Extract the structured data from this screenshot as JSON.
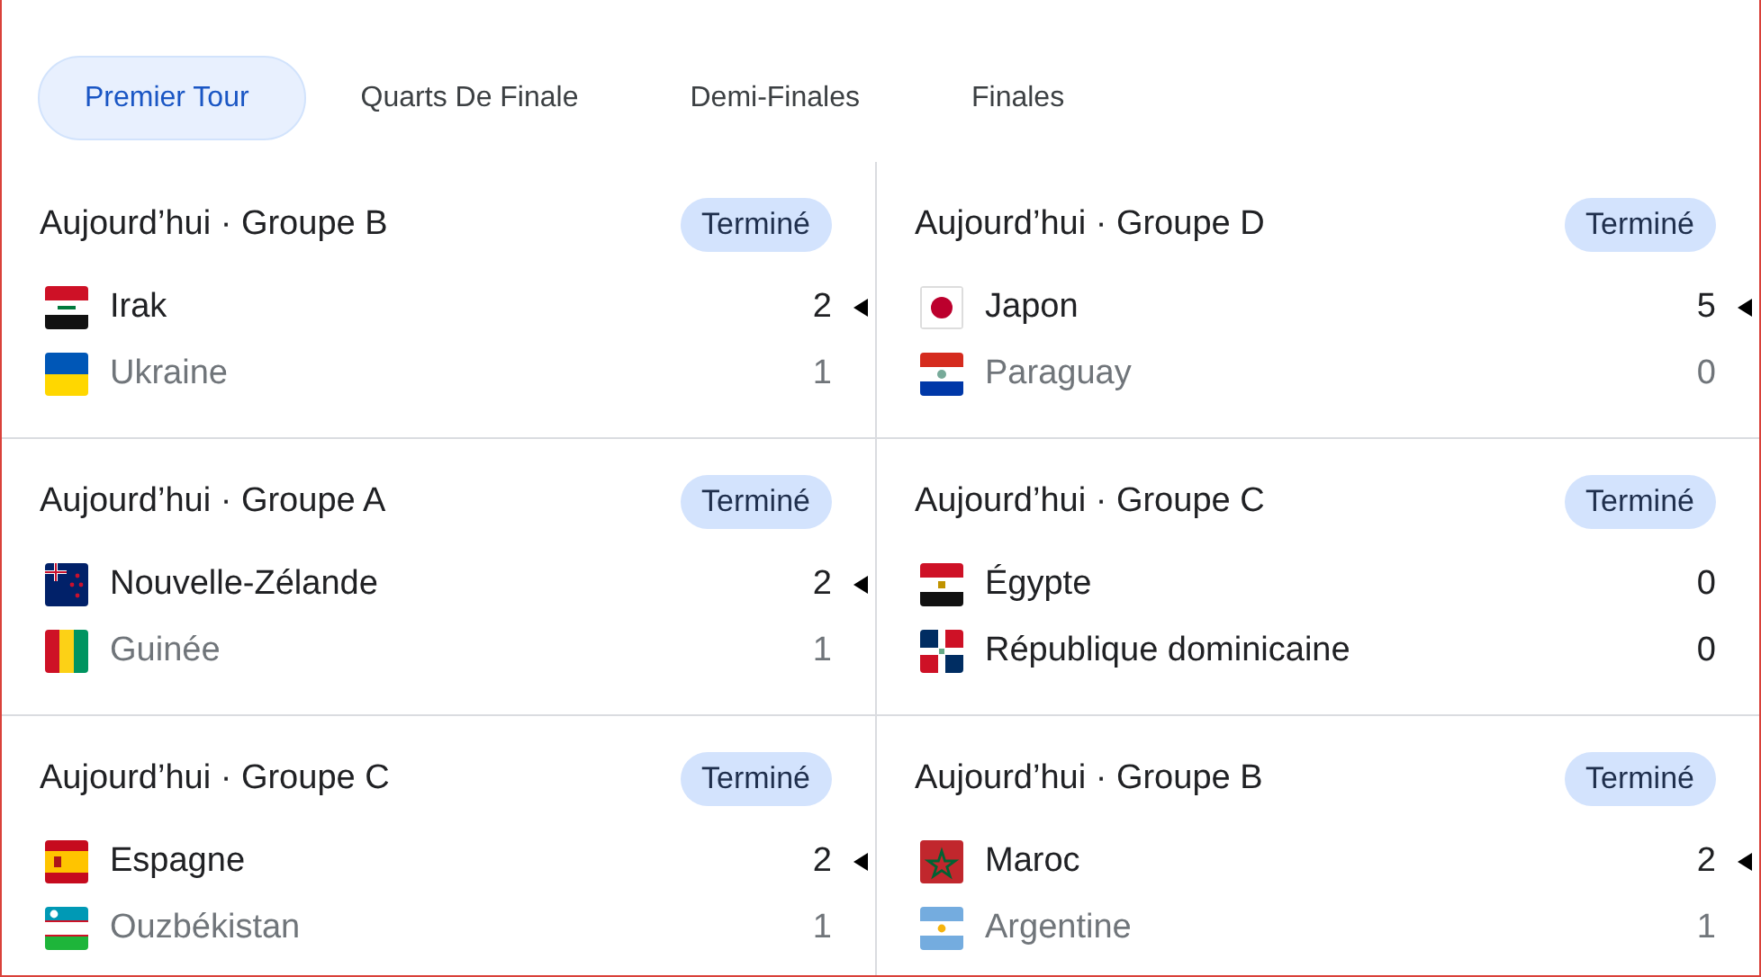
{
  "tabs": [
    {
      "label": "Premier Tour",
      "selected": true
    },
    {
      "label": "Quarts De Finale",
      "selected": false
    },
    {
      "label": "Demi-Finales",
      "selected": false
    },
    {
      "label": "Finales",
      "selected": false
    }
  ],
  "matches": [
    {
      "header": "Aujourd’hui · Groupe B",
      "status": "Terminé",
      "teams": [
        {
          "kind": "iq",
          "name": "Irak",
          "score": "2",
          "winner": true,
          "dimmed": false
        },
        {
          "kind": "ua",
          "name": "Ukraine",
          "score": "1",
          "winner": false,
          "dimmed": true
        }
      ]
    },
    {
      "header": "Aujourd’hui · Groupe D",
      "status": "Terminé",
      "teams": [
        {
          "kind": "jp",
          "name": "Japon",
          "score": "5",
          "winner": true,
          "dimmed": false
        },
        {
          "kind": "py",
          "name": "Paraguay",
          "score": "0",
          "winner": false,
          "dimmed": true
        }
      ]
    },
    {
      "header": "Aujourd’hui · Groupe A",
      "status": "Terminé",
      "teams": [
        {
          "kind": "nz",
          "name": "Nouvelle-Zélande",
          "score": "2",
          "winner": true,
          "dimmed": false
        },
        {
          "kind": "gn",
          "name": "Guinée",
          "score": "1",
          "winner": false,
          "dimmed": true
        }
      ]
    },
    {
      "header": "Aujourd’hui · Groupe C",
      "status": "Terminé",
      "teams": [
        {
          "kind": "eg",
          "name": "Égypte",
          "score": "0",
          "winner": false,
          "dimmed": false
        },
        {
          "kind": "do",
          "name": "République dominicaine",
          "score": "0",
          "winner": false,
          "dimmed": false
        }
      ]
    },
    {
      "header": "Aujourd’hui · Groupe C",
      "status": "Terminé",
      "teams": [
        {
          "kind": "es",
          "name": "Espagne",
          "score": "2",
          "winner": true,
          "dimmed": false
        },
        {
          "kind": "uz",
          "name": "Ouzbékistan",
          "score": "1",
          "winner": false,
          "dimmed": true
        }
      ]
    },
    {
      "header": "Aujourd’hui · Groupe B",
      "status": "Terminé",
      "teams": [
        {
          "kind": "ma",
          "name": "Maroc",
          "score": "2",
          "winner": true,
          "dimmed": false
        },
        {
          "kind": "ar",
          "name": "Argentine",
          "score": "1",
          "winner": false,
          "dimmed": true
        }
      ]
    }
  ]
}
